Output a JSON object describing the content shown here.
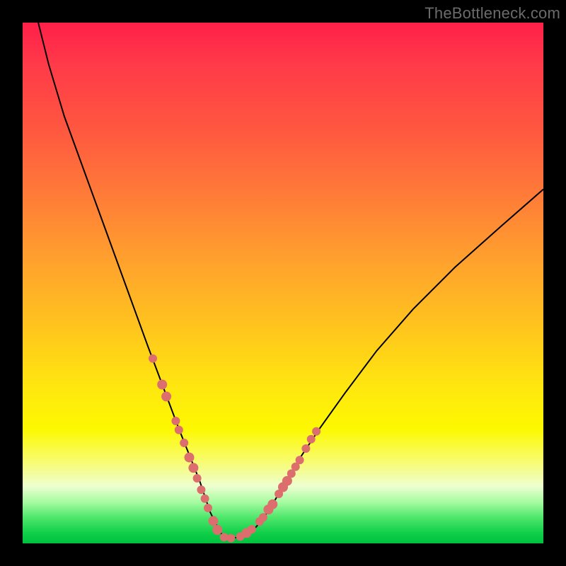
{
  "watermark": "TheBottleneck.com",
  "chart_data": {
    "type": "line",
    "title": "",
    "xlabel": "",
    "ylabel": "",
    "xlim": [
      0,
      100
    ],
    "ylim": [
      0,
      100
    ],
    "series": [
      {
        "name": "bottleneck-curve",
        "x": [
          3,
          5,
          8,
          12,
          16,
          20,
          24,
          27,
          30,
          32,
          34,
          35,
          36,
          37,
          38,
          39,
          40,
          42,
          44,
          46,
          48,
          50,
          53,
          57,
          62,
          68,
          75,
          83,
          92,
          100
        ],
        "values": [
          100,
          92,
          82,
          71,
          60,
          49,
          38,
          30,
          22,
          17,
          12,
          9,
          6,
          4,
          2,
          1.2,
          1,
          1.2,
          2.2,
          4.5,
          7.5,
          11,
          16,
          22,
          29,
          37,
          45,
          53,
          61,
          68
        ]
      }
    ],
    "markers": {
      "name": "highlighted-points",
      "color": "#dc6e6e",
      "points": [
        {
          "x": 25.0,
          "y": 35.5,
          "r": 6
        },
        {
          "x": 26.8,
          "y": 30.5,
          "r": 7
        },
        {
          "x": 27.6,
          "y": 28.2,
          "r": 7
        },
        {
          "x": 29.4,
          "y": 23.5,
          "r": 6
        },
        {
          "x": 30.0,
          "y": 21.8,
          "r": 6
        },
        {
          "x": 31.0,
          "y": 19.3,
          "r": 6
        },
        {
          "x": 32.0,
          "y": 16.5,
          "r": 7
        },
        {
          "x": 32.8,
          "y": 14.5,
          "r": 7
        },
        {
          "x": 33.5,
          "y": 12.5,
          "r": 6
        },
        {
          "x": 34.3,
          "y": 10.3,
          "r": 6
        },
        {
          "x": 35.0,
          "y": 8.6,
          "r": 6
        },
        {
          "x": 35.6,
          "y": 6.8,
          "r": 6
        },
        {
          "x": 36.6,
          "y": 4.3,
          "r": 7
        },
        {
          "x": 37.4,
          "y": 2.6,
          "r": 7
        },
        {
          "x": 38.7,
          "y": 1.2,
          "r": 6
        },
        {
          "x": 40.0,
          "y": 1.0,
          "r": 6
        },
        {
          "x": 41.8,
          "y": 1.3,
          "r": 6
        },
        {
          "x": 43.0,
          "y": 2.0,
          "r": 7
        },
        {
          "x": 44.0,
          "y": 2.7,
          "r": 6
        },
        {
          "x": 45.5,
          "y": 4.2,
          "r": 6
        },
        {
          "x": 46.2,
          "y": 5.0,
          "r": 6
        },
        {
          "x": 47.2,
          "y": 6.5,
          "r": 7
        },
        {
          "x": 48.0,
          "y": 7.5,
          "r": 7
        },
        {
          "x": 49.2,
          "y": 9.5,
          "r": 6
        },
        {
          "x": 50.0,
          "y": 10.8,
          "r": 7
        },
        {
          "x": 50.8,
          "y": 12.0,
          "r": 7
        },
        {
          "x": 51.6,
          "y": 13.4,
          "r": 6
        },
        {
          "x": 52.4,
          "y": 14.7,
          "r": 6
        },
        {
          "x": 53.2,
          "y": 16.0,
          "r": 6
        },
        {
          "x": 54.4,
          "y": 18.2,
          "r": 6
        },
        {
          "x": 55.4,
          "y": 20.0,
          "r": 6
        },
        {
          "x": 56.4,
          "y": 21.5,
          "r": 6
        }
      ]
    }
  }
}
